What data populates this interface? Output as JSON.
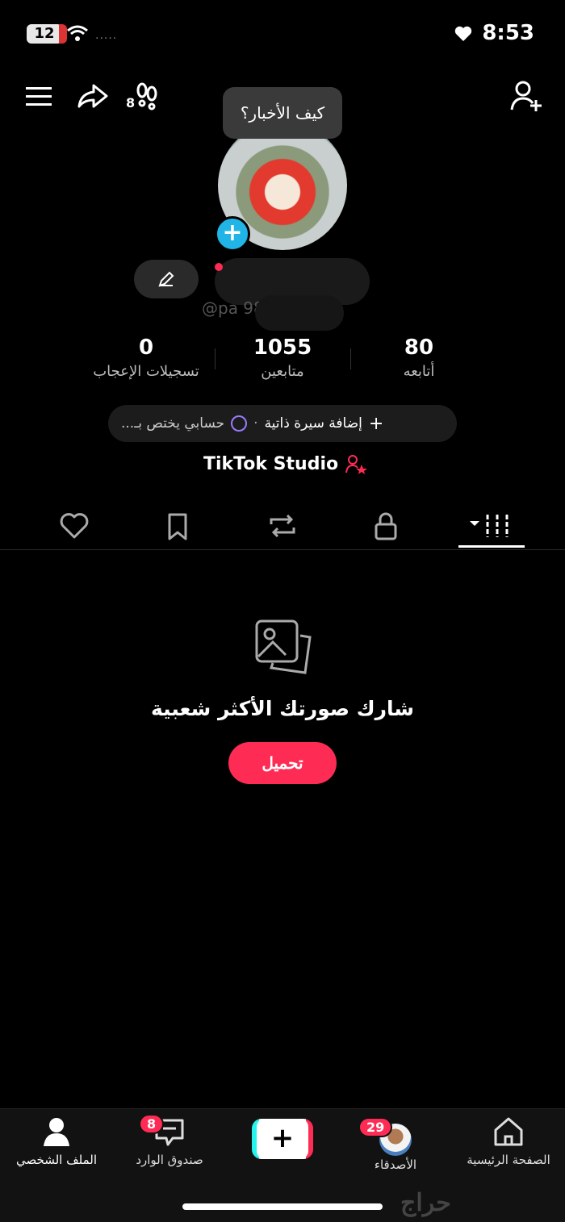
{
  "status_bar": {
    "battery": "12",
    "time": "8:53",
    "signal_dots": "....."
  },
  "top_bar": {
    "steps_count": "8"
  },
  "tooltip": {
    "text": "كيف الأخبار؟"
  },
  "profile": {
    "handle": "@pa     98",
    "stats": {
      "following": {
        "value": "80",
        "label": "أتابعه"
      },
      "followers": {
        "value": "1055",
        "label": "متابعين"
      },
      "likes": {
        "value": "0",
        "label": "تسجيلات الإعجاب"
      }
    },
    "bio": {
      "add_label": "إضافة سيرة ذاتية",
      "separator": "·",
      "text": "حسابي يختص بـ..."
    },
    "studio_label": "TikTok Studio"
  },
  "empty_state": {
    "title": "شارك صورتك الأكثر شعبية",
    "button": "تحميل"
  },
  "bottom_nav": {
    "home": "الصفحة الرئيسية",
    "friends": "الأصدقاء",
    "friends_badge": "29",
    "inbox": "صندوق الوارد",
    "inbox_badge": "8",
    "profile": "الملف الشخصي"
  },
  "watermark": "حراج",
  "colors": {
    "accent": "#fe2c55",
    "plus_blue": "#20b5e6",
    "cyan": "#25f4ee"
  }
}
